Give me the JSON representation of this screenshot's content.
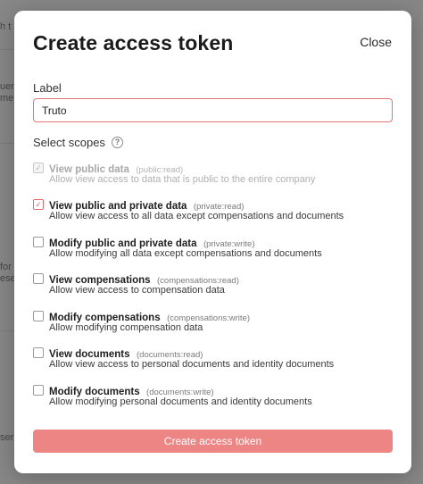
{
  "background": {
    "fragments": [
      "h t",
      "uen",
      "men",
      "for",
      "ese",
      "ser"
    ]
  },
  "modal": {
    "title": "Create access token",
    "close_label": "Close",
    "label_field": {
      "label": "Label",
      "value": "Truto"
    },
    "scopes_heading": "Select scopes",
    "scopes": [
      {
        "name": "View public data",
        "key": "(public:read)",
        "description": "Allow view access to data that is public to the entire company",
        "checked": true,
        "disabled": true
      },
      {
        "name": "View public and private data",
        "key": "(private:read)",
        "description": "Allow view access to all data except compensations and documents",
        "checked": true,
        "disabled": false
      },
      {
        "name": "Modify public and private data",
        "key": "(private:write)",
        "description": "Allow modifying all data except compensations and documents",
        "checked": false,
        "disabled": false
      },
      {
        "name": "View compensations",
        "key": "(compensations:read)",
        "description": "Allow view access to compensation data",
        "checked": false,
        "disabled": false
      },
      {
        "name": "Modify compensations",
        "key": "(compensations:write)",
        "description": "Allow modifying compensation data",
        "checked": false,
        "disabled": false
      },
      {
        "name": "View documents",
        "key": "(documents:read)",
        "description": "Allow view access to personal documents and identity documents",
        "checked": false,
        "disabled": false
      },
      {
        "name": "Modify documents",
        "key": "(documents:write)",
        "description": "Allow modifying personal documents and identity documents",
        "checked": false,
        "disabled": false
      }
    ],
    "submit_label": "Create access token"
  },
  "colors": {
    "accent": "#e67474",
    "submit_bg": "#ee8585"
  }
}
